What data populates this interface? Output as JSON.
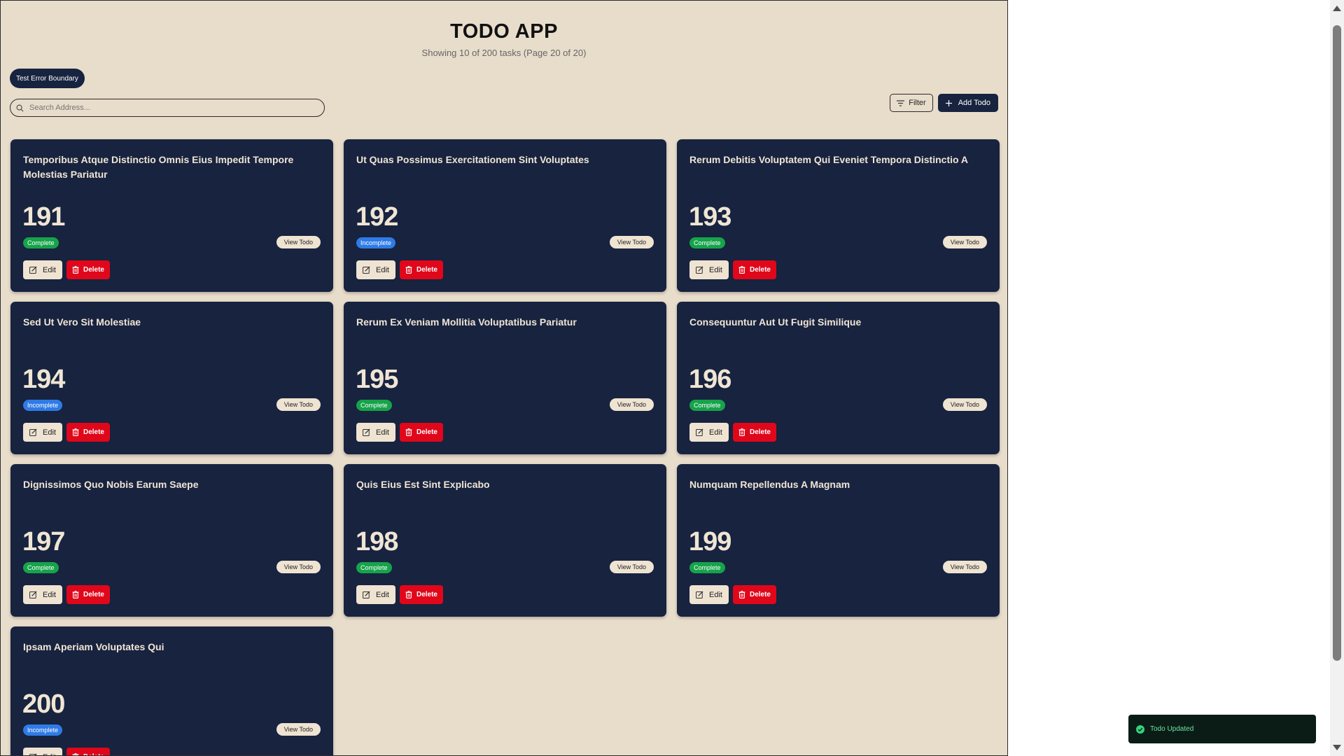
{
  "app": {
    "title": "TODO APP",
    "subtitle": "Showing 10 of 200 tasks (Page 20 of 20)"
  },
  "controls": {
    "test_error_label": "Test Error Boundary",
    "search_placeholder": "Search Address...",
    "search_value": "",
    "filter_label": "Filter",
    "add_label": "Add Todo"
  },
  "card_labels": {
    "view": "View Todo",
    "edit": "Edit",
    "delete": "Delete"
  },
  "todos": [
    {
      "id": "191",
      "title": "Temporibus Atque Distinctio Omnis Eius Impedit Tempore Molestias Pariatur",
      "status": "Complete"
    },
    {
      "id": "192",
      "title": "Ut Quas Possimus Exercitationem Sint Voluptates",
      "status": "Incomplete"
    },
    {
      "id": "193",
      "title": "Rerum Debitis Voluptatem Qui Eveniet Tempora Distinctio A",
      "status": "Complete"
    },
    {
      "id": "194",
      "title": "Sed Ut Vero Sit Molestiae",
      "status": "Incomplete"
    },
    {
      "id": "195",
      "title": "Rerum Ex Veniam Mollitia Voluptatibus Pariatur",
      "status": "Complete"
    },
    {
      "id": "196",
      "title": "Consequuntur Aut Ut Fugit Similique",
      "status": "Complete"
    },
    {
      "id": "197",
      "title": "Dignissimos Quo Nobis Earum Saepe",
      "status": "Complete"
    },
    {
      "id": "198",
      "title": "Quis Eius Est Sint Explicabo",
      "status": "Complete"
    },
    {
      "id": "199",
      "title": "Numquam Repellendus A Magnam",
      "status": "Complete"
    },
    {
      "id": "200",
      "title": "Ipsam Aperiam Voluptates Qui",
      "status": "Incomplete"
    }
  ],
  "toast": {
    "message": "Todo Updated"
  },
  "colors": {
    "page_background": "#e8dccb",
    "card_background": "#17233f",
    "complete": "#16a34a",
    "incomplete": "#2f7be6",
    "delete": "#e0071b",
    "toast_background": "#0a1c15",
    "toast_text": "#6fe3a4"
  },
  "icons": {
    "search": "search-icon",
    "filter": "filter-icon",
    "add": "plus-icon",
    "edit": "edit-icon",
    "delete": "trash-icon",
    "toast": "check-circle-icon"
  }
}
